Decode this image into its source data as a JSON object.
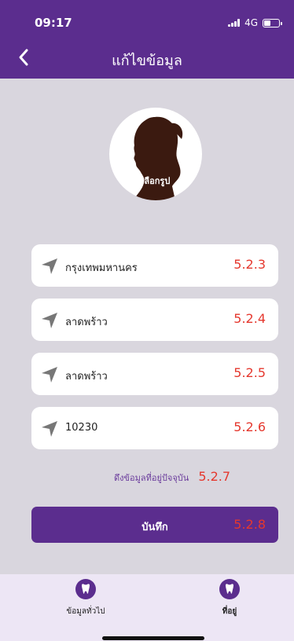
{
  "status_bar": {
    "time": "09:17",
    "network": "4G"
  },
  "header": {
    "title": "แก้ไขข้อมูล"
  },
  "avatar": {
    "label": "เลือกรูป"
  },
  "fields": [
    {
      "value": "กรุงเทพมหานคร",
      "tag": "5.2.3"
    },
    {
      "value": "ลาดพร้าว",
      "tag": "5.2.4"
    },
    {
      "value": "ลาดพร้าว",
      "tag": "5.2.5"
    },
    {
      "value": "10230",
      "tag": "5.2.6"
    }
  ],
  "fetch_location": {
    "label": "ดึงข้อมูลที่อยู่ปัจจุบัน",
    "tag": "5.2.7"
  },
  "save_button": {
    "label": "บันทึก",
    "tag": "5.2.8"
  },
  "tabs": [
    {
      "label": "ข้อมูลทั่วไป",
      "icon": "tooth-icon"
    },
    {
      "label": "ที่อยู่",
      "icon": "tooth-icon",
      "active": true
    }
  ],
  "colors": {
    "brand": "#5b2d8e",
    "annotation": "#e5382e",
    "background": "#d9d6de"
  }
}
